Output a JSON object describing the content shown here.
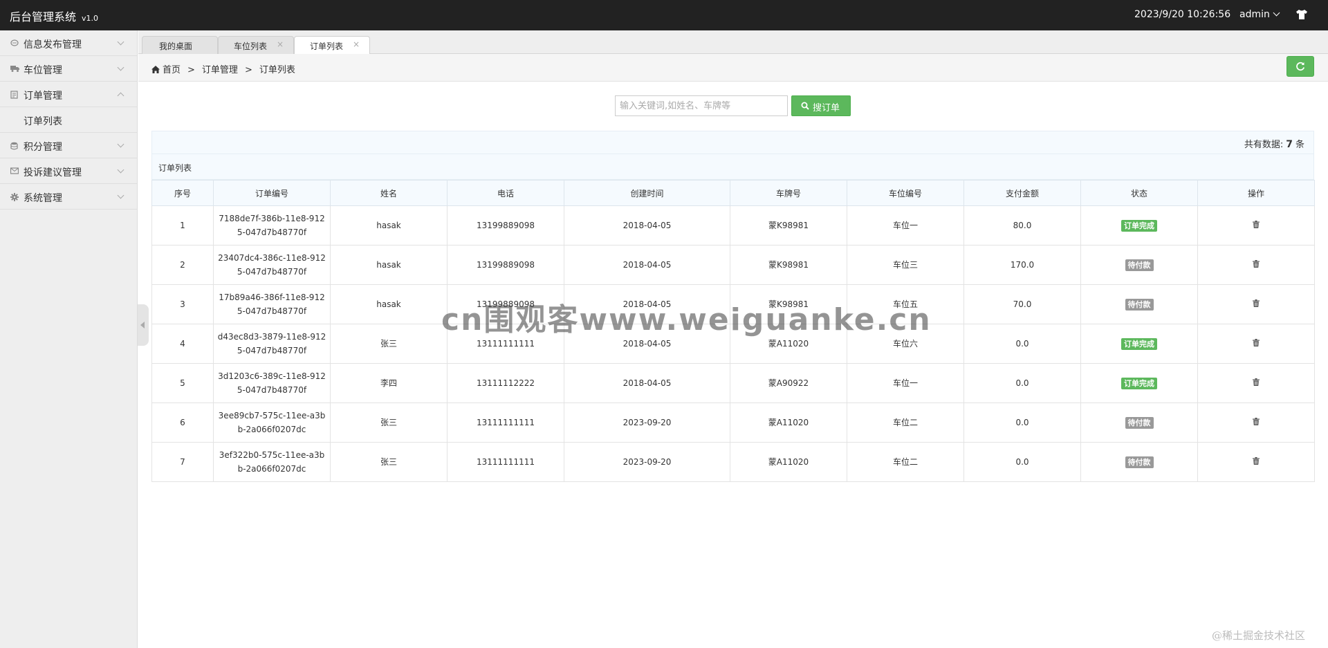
{
  "header": {
    "app_title": "后台管理系统",
    "version": "v1.0",
    "datetime": "2023/9/20 10:26:56",
    "user": "admin"
  },
  "sidebar": {
    "items": [
      {
        "label": "信息发布管理",
        "icon": "message-icon",
        "expanded": false
      },
      {
        "label": "车位管理",
        "icon": "truck-icon",
        "expanded": false
      },
      {
        "label": "订单管理",
        "icon": "clipboard-icon",
        "expanded": true
      },
      {
        "label": "积分管理",
        "icon": "database-icon",
        "expanded": false
      },
      {
        "label": "投诉建议管理",
        "icon": "envelope-icon",
        "expanded": false
      },
      {
        "label": "系统管理",
        "icon": "gear-icon",
        "expanded": false
      }
    ],
    "subitem": "订单列表"
  },
  "tabs": [
    {
      "label": "我的桌面",
      "active": false
    },
    {
      "label": "车位列表",
      "active": false
    },
    {
      "label": "订单列表",
      "active": true
    }
  ],
  "breadcrumb": [
    "首页",
    "订单管理",
    "订单列表"
  ],
  "search": {
    "placeholder": "输入关键词,如姓名、车牌等",
    "button_label": "搜订单"
  },
  "count": {
    "prefix": "共有数据:",
    "value": "7",
    "suffix": "条"
  },
  "panel_title": "订单列表",
  "table": {
    "columns": [
      "序号",
      "订单编号",
      "姓名",
      "电话",
      "创建时间",
      "车牌号",
      "车位编号",
      "支付金额",
      "状态",
      "操作"
    ],
    "rows": [
      {
        "no": "1",
        "order_id_1": "7188de7f-386b-11e8-912",
        "order_id_2": "5-047d7b48770f",
        "name": "hasak",
        "phone": "13199889098",
        "created": "2018-04-05",
        "plate": "蒙K98981",
        "spot": "车位一",
        "amount": "80.0",
        "status": "订单完成",
        "status_type": "done"
      },
      {
        "no": "2",
        "order_id_1": "23407dc4-386c-11e8-912",
        "order_id_2": "5-047d7b48770f",
        "name": "hasak",
        "phone": "13199889098",
        "created": "2018-04-05",
        "plate": "蒙K98981",
        "spot": "车位三",
        "amount": "170.0",
        "status": "待付款",
        "status_type": "pending"
      },
      {
        "no": "3",
        "order_id_1": "17b89a46-386f-11e8-912",
        "order_id_2": "5-047d7b48770f",
        "name": "hasak",
        "phone": "13199889098",
        "created": "2018-04-05",
        "plate": "蒙K98981",
        "spot": "车位五",
        "amount": "70.0",
        "status": "待付款",
        "status_type": "pending"
      },
      {
        "no": "4",
        "order_id_1": "d43ec8d3-3879-11e8-912",
        "order_id_2": "5-047d7b48770f",
        "name": "张三",
        "phone": "13111111111",
        "created": "2018-04-05",
        "plate": "蒙A11020",
        "spot": "车位六",
        "amount": "0.0",
        "status": "订单完成",
        "status_type": "done"
      },
      {
        "no": "5",
        "order_id_1": "3d1203c6-389c-11e8-912",
        "order_id_2": "5-047d7b48770f",
        "name": "李四",
        "phone": "13111112222",
        "created": "2018-04-05",
        "plate": "蒙A90922",
        "spot": "车位一",
        "amount": "0.0",
        "status": "订单完成",
        "status_type": "done"
      },
      {
        "no": "6",
        "order_id_1": "3ee89cb7-575c-11ee-a3b",
        "order_id_2": "b-2a066f0207dc",
        "name": "张三",
        "phone": "13111111111",
        "created": "2023-09-20",
        "plate": "蒙A11020",
        "spot": "车位二",
        "amount": "0.0",
        "status": "待付款",
        "status_type": "pending"
      },
      {
        "no": "7",
        "order_id_1": "3ef322b0-575c-11ee-a3b",
        "order_id_2": "b-2a066f0207dc",
        "name": "张三",
        "phone": "13111111111",
        "created": "2023-09-20",
        "plate": "蒙A11020",
        "spot": "车位二",
        "amount": "0.0",
        "status": "待付款",
        "status_type": "pending"
      }
    ]
  },
  "watermark": "cn围观客www.weiguanke.cn",
  "corner_mark": "@稀土掘金技术社区",
  "colors": {
    "accent_green": "#5cb85c",
    "pending_gray": "#999999",
    "topbar": "#222222"
  }
}
